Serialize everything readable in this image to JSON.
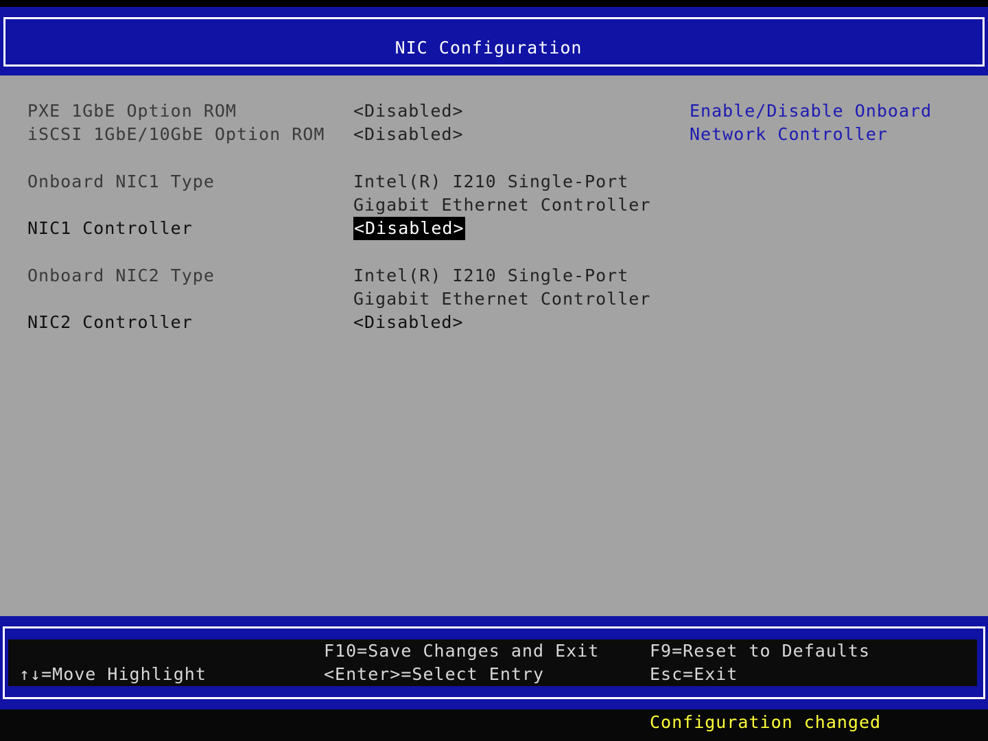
{
  "header": {
    "title": "NIC Configuration"
  },
  "settings": [
    {
      "label": "PXE 1GbE Option ROM",
      "value": "<Disabled>"
    },
    {
      "label": "iSCSI 1GbE/10GbE Option ROM",
      "value": "<Disabled>"
    },
    {
      "label": "Onboard NIC1 Type",
      "value_line1": "Intel(R) I210 Single-Port",
      "value_line2": "Gigabit Ethernet Controller"
    },
    {
      "label": "NIC1 Controller",
      "value": "<Disabled>",
      "selected": true
    },
    {
      "label": "Onboard NIC2 Type",
      "value_line1": "Intel(R) I210 Single-Port",
      "value_line2": "Gigabit Ethernet Controller"
    },
    {
      "label": "NIC2 Controller",
      "value": "<Disabled>"
    }
  ],
  "help": {
    "line1": "Enable/Disable Onboard",
    "line2": "Network Controller"
  },
  "footer": {
    "move_highlight": "↑↓=Move Highlight",
    "save_exit": "F10=Save Changes and Exit",
    "select_entry": "<Enter>=Select Entry",
    "reset_defaults": "F9=Reset to Defaults",
    "esc_exit": "Esc=Exit"
  },
  "status": {
    "message": "Configuration changed"
  },
  "colors": {
    "header_bg": "#1013a3",
    "main_bg": "#a3a3a3",
    "help_text": "#1d1ab3",
    "status_text": "#ffff3a",
    "selected_bg": "#000000"
  }
}
